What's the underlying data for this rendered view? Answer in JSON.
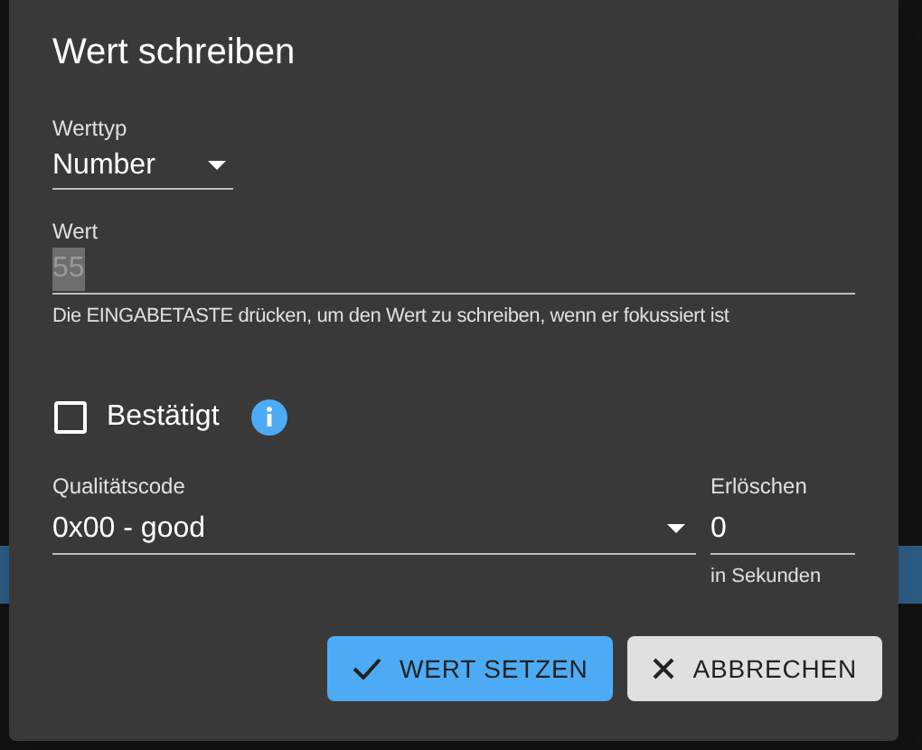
{
  "dialog": {
    "title": "Wert schreiben",
    "value_type": {
      "label": "Werttyp",
      "value": "Number"
    },
    "value": {
      "label": "Wert",
      "value": "55",
      "text_selected": true,
      "helper": "Die EINGABETASTE drücken, um den Wert zu schreiben, wenn er fokussiert ist"
    },
    "confirmed": {
      "label": "Bestätigt",
      "checked": false
    },
    "quality": {
      "label": "Qualitätscode",
      "value": "0x00 - good"
    },
    "expire": {
      "label": "Erlöschen",
      "value": "0",
      "helper": "in Sekunden"
    },
    "buttons": [
      {
        "kind": "primary",
        "label": "WERT SETZEN"
      },
      {
        "kind": "secondary",
        "label": "ABBRECHEN"
      }
    ]
  }
}
